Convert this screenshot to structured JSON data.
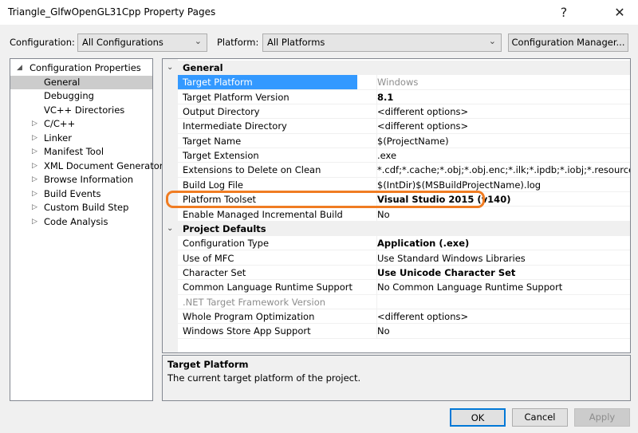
{
  "window": {
    "title": "Triangle_GlfwOpenGL31Cpp Property Pages",
    "help": "?",
    "close": "✕"
  },
  "toolbar": {
    "config_label": "Configuration:",
    "config_value": "All Configurations",
    "platform_label": "Platform:",
    "platform_value": "All Platforms",
    "config_manager": "Configuration Manager..."
  },
  "tree": [
    {
      "label": "Configuration Properties",
      "level": 0,
      "arrow": "◢",
      "expanded": true
    },
    {
      "label": "General",
      "level": 1,
      "selected": true
    },
    {
      "label": "Debugging",
      "level": 1
    },
    {
      "label": "VC++ Directories",
      "level": 1
    },
    {
      "label": "C/C++",
      "level": 1,
      "arrow": "▷"
    },
    {
      "label": "Linker",
      "level": 1,
      "arrow": "▷"
    },
    {
      "label": "Manifest Tool",
      "level": 1,
      "arrow": "▷"
    },
    {
      "label": "XML Document Generator",
      "level": 1,
      "arrow": "▷"
    },
    {
      "label": "Browse Information",
      "level": 1,
      "arrow": "▷"
    },
    {
      "label": "Build Events",
      "level": 1,
      "arrow": "▷"
    },
    {
      "label": "Custom Build Step",
      "level": 1,
      "arrow": "▷"
    },
    {
      "label": "Code Analysis",
      "level": 1,
      "arrow": "▷"
    }
  ],
  "grid": [
    {
      "category": "General"
    },
    {
      "name": "Target Platform",
      "value": "Windows",
      "selected": true,
      "value_dim": true
    },
    {
      "name": "Target Platform Version",
      "value": "8.1",
      "bold": true
    },
    {
      "name": "Output Directory",
      "value": "<different options>"
    },
    {
      "name": "Intermediate Directory",
      "value": "<different options>"
    },
    {
      "name": "Target Name",
      "value": "$(ProjectName)"
    },
    {
      "name": "Target Extension",
      "value": ".exe"
    },
    {
      "name": "Extensions to Delete on Clean",
      "value": "*.cdf;*.cache;*.obj;*.obj.enc;*.ilk;*.ipdb;*.iobj;*.resources;*.tlb;*.tli;*.tlh;*.tmp"
    },
    {
      "name": "Build Log File",
      "value": "$(IntDir)$(MSBuildProjectName).log"
    },
    {
      "name": "Platform Toolset",
      "value": "Visual Studio 2015 (v140)",
      "bold": true
    },
    {
      "name": "Enable Managed Incremental Build",
      "value": "No"
    },
    {
      "category": "Project Defaults"
    },
    {
      "name": "Configuration Type",
      "value": "Application (.exe)",
      "bold": true
    },
    {
      "name": "Use of MFC",
      "value": "Use Standard Windows Libraries"
    },
    {
      "name": "Character Set",
      "value": "Use Unicode Character Set",
      "bold": true
    },
    {
      "name": "Common Language Runtime Support",
      "value": "No Common Language Runtime Support"
    },
    {
      "name": ".NET Target Framework Version",
      "value": "",
      "name_dim": true
    },
    {
      "name": "Whole Program Optimization",
      "value": "<different options>"
    },
    {
      "name": "Windows Store App Support",
      "value": "No"
    }
  ],
  "description": {
    "title": "Target Platform",
    "text": "The current target platform of the project."
  },
  "buttons": {
    "ok": "OK",
    "cancel": "Cancel",
    "apply": "Apply"
  },
  "colors": {
    "selection": "#3399ff",
    "highlight_outline": "#f07c22"
  }
}
